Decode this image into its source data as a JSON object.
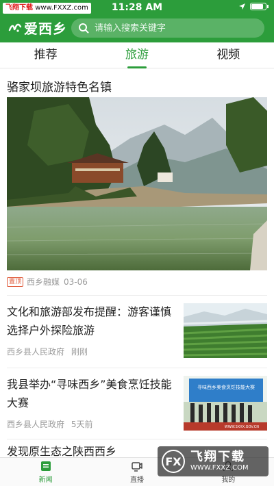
{
  "status_bar": {
    "watermark_red": "飞翔下载",
    "watermark_url": "www.FXXZ.com",
    "time": "11:28 AM"
  },
  "header": {
    "logo_text": "爱西乡",
    "search": {
      "placeholder": "请输入搜索关键字"
    }
  },
  "tabs": [
    {
      "label": "推荐",
      "active": false
    },
    {
      "label": "旅游",
      "active": true
    },
    {
      "label": "视频",
      "active": false
    }
  ],
  "feed": {
    "featured": {
      "title": "骆家坝旅游特色名镇",
      "badge": "置顶",
      "source": "西乡融媒",
      "date": "03-06"
    },
    "items": [
      {
        "title": "文化和旅游部发布提醒：游客谨慎选择户外探险旅游",
        "source": "西乡县人民政府",
        "time": "刚刚"
      },
      {
        "title": "我县举办“寻味西乡”美食烹饪技能大赛",
        "source": "西乡县人民政府",
        "time": "5天前",
        "banner_text": "寻味西乡美食烹饪技能大赛",
        "image_url_text": "WWW.SXXX.GOV.CN"
      }
    ],
    "partial_title": "发现原生态之陕西西乡"
  },
  "bottom_nav": [
    {
      "label": "新闻",
      "active": true
    },
    {
      "label": "直播",
      "active": false
    },
    {
      "label": "我的",
      "active": false
    }
  ],
  "watermark_bottom": {
    "logo": "FX",
    "text": "飞翔下载",
    "url": "WWW.FXXZ.COM"
  },
  "colors": {
    "brand_green": "#2c9d3b",
    "badge_red": "#e05a3a"
  }
}
